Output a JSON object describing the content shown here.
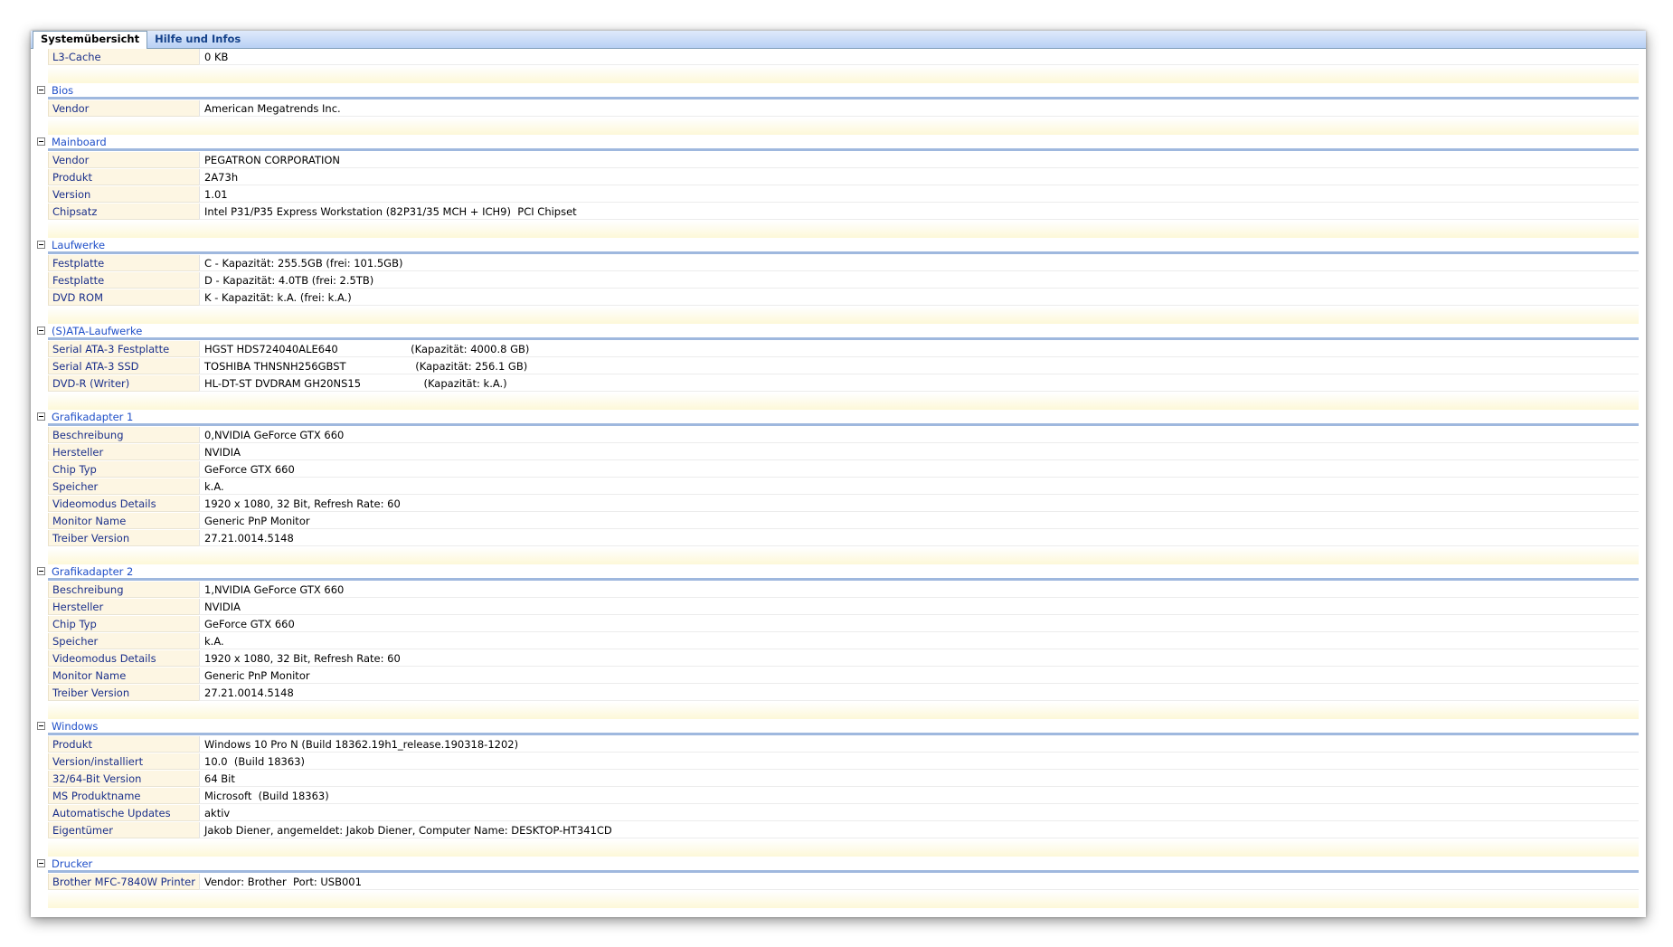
{
  "tabs": [
    {
      "label": "Systemübersicht",
      "active": true
    },
    {
      "label": "Hilfe und Infos",
      "active": false
    }
  ],
  "rows": [
    {
      "type": "item",
      "key": "L3-Cache",
      "value": "0 KB"
    },
    {
      "type": "spacer"
    },
    {
      "type": "header",
      "title": "Bios"
    },
    {
      "type": "item",
      "key": "Vendor",
      "value": "American Megatrends Inc."
    },
    {
      "type": "spacer"
    },
    {
      "type": "header",
      "title": "Mainboard"
    },
    {
      "type": "item",
      "key": "Vendor",
      "value": "PEGATRON CORPORATION"
    },
    {
      "type": "item",
      "key": "Produkt",
      "value": "2A73h"
    },
    {
      "type": "item",
      "key": "Version",
      "value": "1.01"
    },
    {
      "type": "item",
      "key": "Chipsatz",
      "value": "Intel P31/P35 Express Workstation (82P31/35 MCH + ICH9)  PCI Chipset"
    },
    {
      "type": "spacer"
    },
    {
      "type": "header",
      "title": "Laufwerke"
    },
    {
      "type": "item",
      "key": "Festplatte",
      "value": "C - Kapazität: 255.5GB (frei: 101.5GB)"
    },
    {
      "type": "item",
      "key": "Festplatte",
      "value": "D - Kapazität: 4.0TB (frei: 2.5TB)"
    },
    {
      "type": "item",
      "key": "DVD ROM",
      "value": "K - Kapazität: k.A. (frei: k.A.)"
    },
    {
      "type": "spacer"
    },
    {
      "type": "header",
      "title": "(S)ATA-Laufwerke"
    },
    {
      "type": "item",
      "key": "Serial ATA-3 Festplatte",
      "value": "HGST HDS724040ALE640                      (Kapazität: 4000.8 GB)"
    },
    {
      "type": "item",
      "key": "Serial ATA-3 SSD",
      "value": "TOSHIBA THNSNH256GBST                     (Kapazität: 256.1 GB)"
    },
    {
      "type": "item",
      "key": "DVD-R (Writer)",
      "value": "HL-DT-ST DVDRAM GH20NS15                   (Kapazität: k.A.)"
    },
    {
      "type": "spacer"
    },
    {
      "type": "header",
      "title": "Grafikadapter 1"
    },
    {
      "type": "item",
      "key": "Beschreibung",
      "value": "0,NVIDIA GeForce GTX 660"
    },
    {
      "type": "item",
      "key": "Hersteller",
      "value": "NVIDIA"
    },
    {
      "type": "item",
      "key": "Chip Typ",
      "value": "GeForce GTX 660"
    },
    {
      "type": "item",
      "key": "Speicher",
      "value": "k.A."
    },
    {
      "type": "item",
      "key": "Videomodus Details",
      "value": "1920 x 1080, 32 Bit, Refresh Rate: 60"
    },
    {
      "type": "item",
      "key": "Monitor Name",
      "value": "Generic PnP Monitor"
    },
    {
      "type": "item",
      "key": "Treiber Version",
      "value": "27.21.0014.5148"
    },
    {
      "type": "spacer"
    },
    {
      "type": "header",
      "title": "Grafikadapter 2"
    },
    {
      "type": "item",
      "key": "Beschreibung",
      "value": "1,NVIDIA GeForce GTX 660"
    },
    {
      "type": "item",
      "key": "Hersteller",
      "value": "NVIDIA"
    },
    {
      "type": "item",
      "key": "Chip Typ",
      "value": "GeForce GTX 660"
    },
    {
      "type": "item",
      "key": "Speicher",
      "value": "k.A."
    },
    {
      "type": "item",
      "key": "Videomodus Details",
      "value": "1920 x 1080, 32 Bit, Refresh Rate: 60"
    },
    {
      "type": "item",
      "key": "Monitor Name",
      "value": "Generic PnP Monitor"
    },
    {
      "type": "item",
      "key": "Treiber Version",
      "value": "27.21.0014.5148"
    },
    {
      "type": "spacer"
    },
    {
      "type": "header",
      "title": "Windows"
    },
    {
      "type": "item",
      "key": "Produkt",
      "value": "Windows 10 Pro N (Build 18362.19h1_release.190318-1202)"
    },
    {
      "type": "item",
      "key": "Version/installiert",
      "value": "10.0  (Build 18363)"
    },
    {
      "type": "item",
      "key": "32/64-Bit Version",
      "value": "64 Bit"
    },
    {
      "type": "item",
      "key": "MS Produktname",
      "value": "Microsoft  (Build 18363)"
    },
    {
      "type": "item",
      "key": "Automatische Updates",
      "value": "aktiv"
    },
    {
      "type": "item",
      "key": "Eigentümer",
      "value": "Jakob Diener, angemeldet: Jakob Diener, Computer Name: DESKTOP-HT341CD"
    },
    {
      "type": "spacer"
    },
    {
      "type": "header",
      "title": "Drucker"
    },
    {
      "type": "item",
      "key": "Brother MFC-7840W Printer",
      "value": "Vendor: Brother  Port: USB001"
    },
    {
      "type": "spacer"
    }
  ]
}
